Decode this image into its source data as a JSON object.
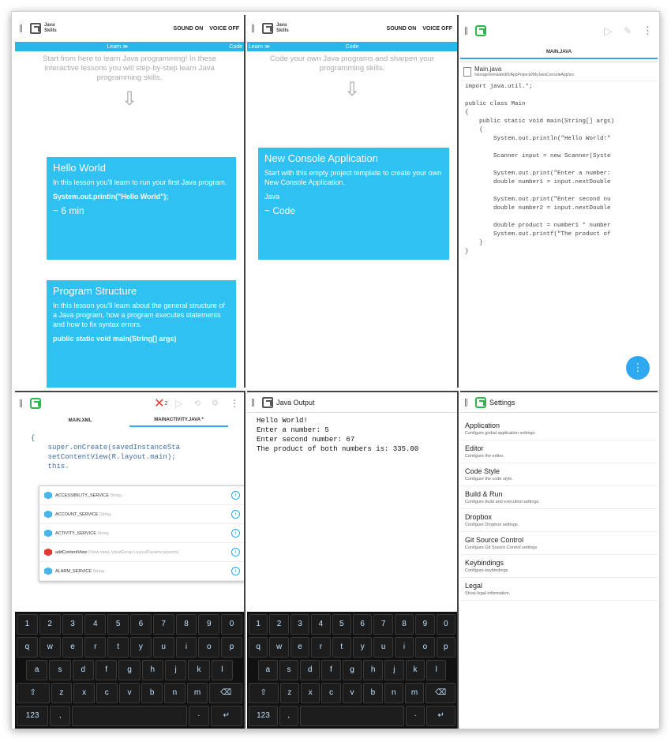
{
  "learn_panel": {
    "app_title_line1": "Java",
    "app_title_line2": "Skills",
    "sound": "SOUND ON",
    "voice": "VOICE OFF",
    "tab_learn": "Learn ≫",
    "tab_code": "Code",
    "intro": "Start from here to learn Java programming! In these interactive lessons you will step-by-step learn Java programming skills.",
    "cards": [
      {
        "title": "Hello World",
        "desc": "In this lesson you'll learn to run your first Java program.",
        "code": "System.out.println(\"Hello World\");",
        "foot": "~ 6 min"
      },
      {
        "title": "Program Structure",
        "desc": "In this lesson you'll learn about the general structure of a Java program, how a program executes statements and how to fix syntax errors.",
        "code": "public static void main(String[] args)"
      }
    ]
  },
  "code_panel": {
    "tab_learn": "Learn ≫",
    "tab_code": "Code",
    "intro": "Code your own Java programs and sharpen your programming skills.",
    "card": {
      "title": "New Console Application",
      "desc": "Start with this empty project template to create your own New Console Application.",
      "lang": "Java",
      "foot": "~ Code"
    }
  },
  "editor_panel": {
    "tab": "MAIN.JAVA",
    "file_name": "Main.java",
    "file_path": "/storage/emulated/0/AppProjects/MyJavaConsoleApp/src",
    "lines": [
      "import java.util.*;",
      "",
      "public class Main",
      "{",
      "    public static void main(String[] args)",
      "    {",
      "        System.out.println(\"Hello World!\"",
      "",
      "        Scanner input = new Scanner(Syste",
      "",
      "        System.out.print(\"Enter a number:",
      "        double number1 = input.nextDouble",
      "",
      "        System.out.print(\"Enter second nu",
      "        double number2 = input.nextDouble",
      "",
      "        double product = number1 * number",
      "        System.out.printf(\"The product of",
      "    }",
      "}"
    ],
    "fab": "⋮"
  },
  "android_panel": {
    "error_count": "2",
    "tab_1": "MAIN.XML",
    "tab_2": "MAINACTIVITY.JAVA *",
    "code_lines": [
      "{",
      "    super.onCreate(savedInstanceSta",
      "    setContentView(R.layout.main);",
      "    this."
    ],
    "suggestions": [
      {
        "name": "ACCESSIBILITY_SERVICE",
        "type": "String",
        "red": false
      },
      {
        "name": "ACCOUNT_SERVICE",
        "type": "String",
        "red": false
      },
      {
        "name": "ACTIVITY_SERVICE",
        "type": "String",
        "red": false
      },
      {
        "name": "addContentView",
        "type": "(View view, ViewGroup.LayoutParams params)",
        "red": true
      },
      {
        "name": "ALARM_SERVICE",
        "type": "String",
        "red": false
      }
    ]
  },
  "output_panel": {
    "title": "Java Output",
    "lines": [
      "Hello World!",
      "Enter a number: 5",
      "Enter second number: 67",
      "The product of both numbers is: 335.00"
    ]
  },
  "settings_panel": {
    "title": "Settings",
    "items": [
      {
        "title": "Application",
        "desc": "Configure global application settings."
      },
      {
        "title": "Editor",
        "desc": "Configure the editor."
      },
      {
        "title": "Code Style",
        "desc": "Configure the code style."
      },
      {
        "title": "Build & Run",
        "desc": "Configure build and execution settings."
      },
      {
        "title": "Dropbox",
        "desc": "Configure Dropbox settings."
      },
      {
        "title": "Git Source Control",
        "desc": "Configure Git Source Control settings."
      },
      {
        "title": "Keybindings",
        "desc": "Configure keybindings."
      },
      {
        "title": "Legal",
        "desc": "Show legal information."
      }
    ]
  },
  "keyboard": {
    "row1": [
      "1",
      "2",
      "3",
      "4",
      "5",
      "6",
      "7",
      "8",
      "9",
      "0"
    ],
    "row2": [
      "q",
      "w",
      "e",
      "r",
      "t",
      "y",
      "u",
      "i",
      "o",
      "p"
    ],
    "row3": [
      "a",
      "s",
      "d",
      "f",
      "g",
      "h",
      "j",
      "k",
      "l"
    ],
    "row4": [
      "⇧",
      "z",
      "x",
      "c",
      "v",
      "b",
      "n",
      "m",
      "⌫"
    ],
    "row5": [
      "123",
      ",",
      "",
      "·",
      "↵"
    ]
  },
  "colors": {
    "accent": "#29b6e8",
    "card": "#2ec1f2",
    "android": "#2db64a",
    "error": "#e53935"
  }
}
